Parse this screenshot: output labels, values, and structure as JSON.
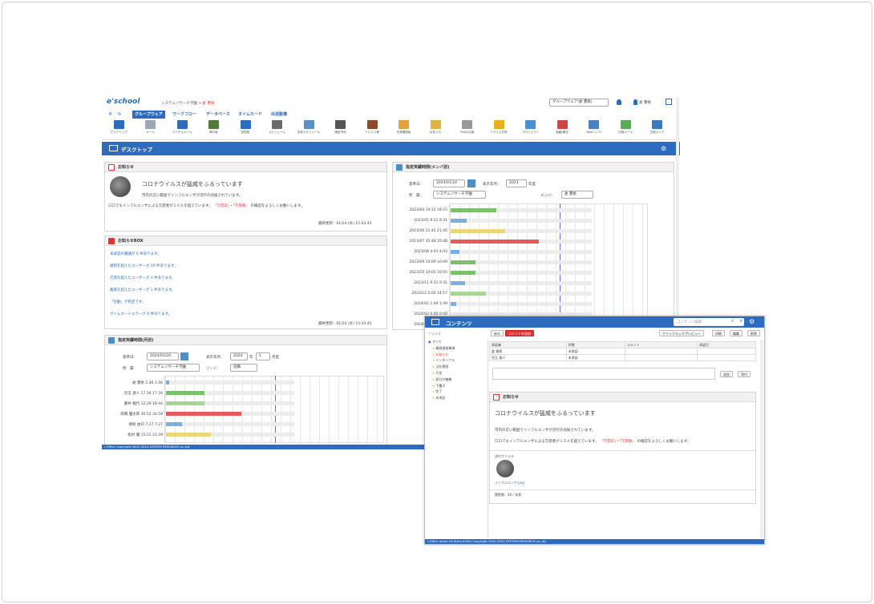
{
  "main": {
    "logo": "e'school",
    "breadcrumb": {
      "system": "システムリサーチ学園",
      "sep": ">",
      "user": "倉 憲帆"
    },
    "group_select": "グループウェア(倉 憲帆)",
    "username": "倉 憲帆",
    "tabs": [
      "グループウェア",
      "ワークフロー",
      "データベース",
      "タイムカード",
      "出退勤簿"
    ],
    "tools": [
      "デスクトップ",
      "メール",
      "コーチルメール",
      "掲示板",
      "回覧板",
      "スケジュール",
      "全体スケジュール",
      "施設予約",
      "アドレス帳",
      "在席確認板",
      "伝言メモ",
      "ToDo/日報",
      "ファイル共有",
      "プロジェクト",
      "稟議/報告",
      "Webリンク",
      "日報メール",
      "日程メンテ"
    ],
    "desktop_title": "デスクトップ",
    "notice": {
      "title": "お知らせ",
      "headline": "コロナウイルスが猛威をふるっています",
      "line1": "市内の広い範囲でインフルエンザが流行の兆候されています。",
      "line2": "ロロでもインフルエンザによる欠席者が１０人を超えています。",
      "tag1": "「欠席日」",
      "tag2": "「欠席数」",
      "line3": "の確認をよろしくお願いします。",
      "updated": "最終更新：01/24 (水) 15:43:43"
    },
    "inbox": {
      "title": "お知らせBOX",
      "items": [
        "未承認の稟議が 6 件あります。",
        "遅刻を超えたユーザーが 19 件あります。",
        "欠席を超えたユーザーが 3 件あります。",
        "着席を超えたユーザーが 1 件あります。",
        "「出勤」が判定です。",
        "タイムカードエラーが 6 件あります。"
      ],
      "updated": "最終更新：01/24 (水) 15:43:43"
    },
    "attendance_member": {
      "title": "指定実績時間(メンバ別)",
      "date_label": "基準日：",
      "date": "2024/01/24",
      "period_label": "表示年月：",
      "period": "2023",
      "period_unit": "年度",
      "dept_label": "所　属：",
      "dept": "システムリサーチ学園",
      "member_label": "メンバ：",
      "member": "倉 憲帆",
      "rows": [
        {
          "label": "2023/04  19:15  19:15",
          "v": 0.26,
          "c": "#7dbf6c"
        },
        {
          "label": "2023/05   9:22   9:31",
          "v": 0.09,
          "c": "#7ab0e0"
        },
        {
          "label": "2023/06  21:45  21:45",
          "v": 0.31,
          "c": "#ecd67a"
        },
        {
          "label": "2023/07  35:48  35:48",
          "v": 0.5,
          "c": "#e85a5a"
        },
        {
          "label": "2023/08   4:03   4:03",
          "v": 0.05,
          "c": "#7ab0e0"
        },
        {
          "label": "2023/09  10:09  10:09",
          "v": 0.14,
          "c": "#7dbf6c"
        },
        {
          "label": "2023/10  10:05  10:05",
          "v": 0.14,
          "c": "#7dbf6c"
        },
        {
          "label": "2023/11   9:31   9:31",
          "v": 0.08,
          "c": "#7ab0e0"
        },
        {
          "label": "2023/12   2:00  14:17",
          "v": 0.2,
          "c": "#a8d494"
        },
        {
          "label": "2024/01   1:49   1:49",
          "v": 0.03,
          "c": "#7ab0e0"
        },
        {
          "label": "2024/02   0:00   0:00",
          "v": 0.0,
          "c": "#7ab0e0"
        },
        {
          "label": "2024/03   0:00   0:00",
          "v": 0.0,
          "c": "#7ab0e0"
        }
      ]
    },
    "attendance_month": {
      "title": "指定実績時間(月別)",
      "date_label": "基準日：",
      "date": "2024/01/24",
      "period_label": "表示年月：",
      "year": "2024",
      "year_unit": "年",
      "month": "1",
      "month_unit": "月度",
      "dept_label": "所　属：",
      "dept": "システムリサーチ学園",
      "sort_label": "ソート：",
      "sort": "役職",
      "rows": [
        {
          "label": "倉 憲帆   1:46   1:46",
          "v": 0.02,
          "c": "#7ab0e0"
        },
        {
          "label": "児玉 達人  17:34  17:34",
          "v": 0.24,
          "c": "#7dbf6c"
        },
        {
          "label": "藤井 雅代  12:29  18:44",
          "v": 0.24,
          "c": "#a8d494"
        },
        {
          "label": "髙橋 優太郎  30:52  34:59",
          "v": 0.47,
          "c": "#e85a5a"
        },
        {
          "label": "頭坂 由司   7:27   7:27",
          "v": 0.1,
          "c": "#7ab0e0"
        },
        {
          "label": "松村 優  15:31  21:39",
          "v": 0.28,
          "c": "#ecd67a"
        }
      ]
    },
    "footer": "i-Office Copyright 2002-2024 SYSTEM RESEARCH co.,ltd."
  },
  "contents": {
    "title": "コンテンツ",
    "search_placeholder": "コンテンツ検索",
    "buttons": {
      "add": "戻る",
      "mark": "コメントを追加",
      "preview": "クイックルックプレビュー",
      "print": "印刷",
      "edit": "編集",
      "delete": "削除"
    },
    "tree_header": "フォルダ",
    "tree": [
      "すべて",
      "業務連絡事項",
      "お知らせ",
      "インターナル",
      "当社規程",
      "不良",
      "部分が編集",
      "下書き",
      "完了",
      "未承認"
    ],
    "table": {
      "headers": [
        "承認者",
        "状態",
        "コメント",
        "承認日"
      ],
      "rows": [
        [
          "倉 憲帆",
          "未承認",
          "",
          ""
        ],
        [
          "児玉 達人",
          "未承認",
          "",
          ""
        ]
      ]
    },
    "comment_btn": "送信",
    "comment_btn2": "添付",
    "notice_title": "お知らせ",
    "headline": "コロナウイルスが猛威をふるっています",
    "line1": "市内の広い範囲でインフルエンザが流行の兆候されています。",
    "line2": "ロロでもインフルエンザによる欠席者が１０人を超えています。",
    "tag1": "「欠席日」",
    "tag2": "「欠席数」",
    "line3": "の確認をよろしくお願いします。",
    "attach_label": "添付ファイル",
    "attach_file": "インフルエンザ.png",
    "views": "閲覧数：26 / 非表：",
    "footer": "i-Office demo V5.6(rev.0180) Copyright 2002-2024 SYSTEM RESEARCH co.,ltd."
  },
  "colors": {
    "accent": "#2d6bbf",
    "alert": "#e33"
  }
}
